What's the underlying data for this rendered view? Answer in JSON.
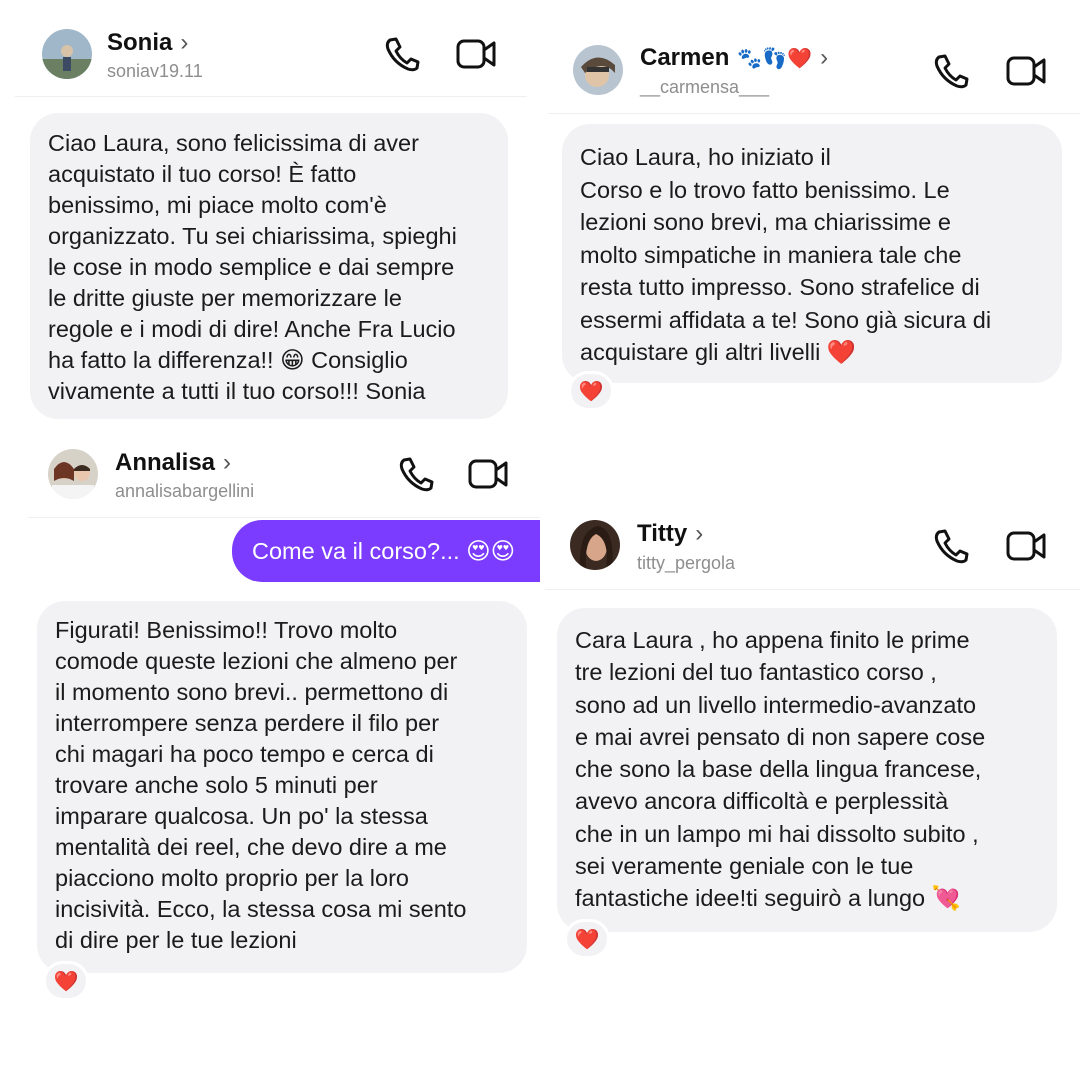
{
  "colors": {
    "bubble_in": "#f2f2f4",
    "bubble_out": "#7c3cff",
    "heart": "#e8232f"
  },
  "chats": [
    {
      "name": "Sonia",
      "username": "soniav19.11",
      "messages": [
        "Ciao Laura, sono felicissima di aver",
        "acquistato il tuo corso! È fatto",
        "benissimo, mi piace molto com'è",
        "organizzato. Tu sei chiarissima, spieghi",
        "le cose in modo semplice e dai sempre",
        "le dritte giuste per memorizzare le",
        "regole e i modi di dire! Anche Fra Lucio",
        "ha fatto la differenza!! 😁  Consiglio",
        "vivamente a tutti il tuo corso!!! Sonia"
      ]
    },
    {
      "name": "Carmen",
      "name_emoji": "🐾👣❤️",
      "username": "__carmensa___",
      "messages": [
        "Ciao Laura, ho iniziato il",
        "Corso e lo trovo fatto benissimo. Le",
        "lezioni sono brevi, ma chiarissime e",
        "molto simpatiche in maniera tale che",
        "resta tutto impresso. Sono strafelice di",
        "essermi affidata a te! Sono già sicura di",
        "acquistare gli altri livelli ❤️"
      ],
      "reaction": "❤️"
    },
    {
      "name": "Annalisa",
      "username": "annalisabargellini",
      "outgoing": "Come va il corso?... 😍😍",
      "messages": [
        "Figurati! Benissimo!! Trovo molto",
        "comode queste lezioni che almeno per",
        "il momento sono brevi.. permettono di",
        "interrompere senza perdere il filo per",
        "chi magari ha poco tempo e cerca di",
        "trovare anche solo 5 minuti per",
        "imparare qualcosa. Un po' la stessa",
        "mentalità dei reel, che devo dire a me",
        "piacciono molto proprio per la loro",
        "incisività.  Ecco, la stessa cosa mi sento",
        "di dire per le tue lezioni"
      ],
      "reaction": "❤️"
    },
    {
      "name": "Titty",
      "username": "titty_pergola",
      "messages": [
        "Cara Laura , ho appena finito le prime",
        "tre lezioni del tuo fantastico corso ,",
        "sono ad un livello intermedio-avanzato",
        "e mai avrei pensato di non sapere cose",
        "che sono la base della lingua francese,",
        "avevo ancora difficoltà e perplessità",
        "che in un lampo mi hai dissolto subito ,",
        "sei veramente geniale con le tue",
        "fantastiche idee!ti seguirò a lungo 💘"
      ],
      "reaction": "❤️"
    }
  ]
}
